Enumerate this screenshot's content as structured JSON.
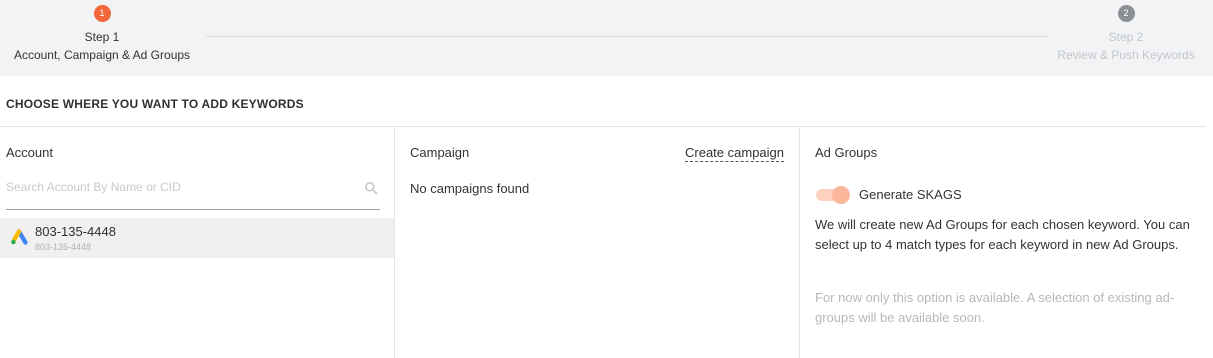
{
  "stepper": {
    "steps": [
      {
        "number": "1",
        "title": "Step 1",
        "subtitle": "Account, Campaign & Ad Groups",
        "state": "active",
        "color": "#f2683a"
      },
      {
        "number": "2",
        "title": "Step 2",
        "subtitle": "Review & Push Keywords",
        "state": "inactive",
        "color": "#8c8f93"
      }
    ]
  },
  "section_title": "CHOOSE WHERE YOU WANT TO ADD KEYWORDS",
  "account": {
    "label": "Account",
    "search": {
      "placeholder": "Search Account By Name or CID",
      "value": ""
    },
    "items": [
      {
        "name": "803-135-4448",
        "id": "803-135-4448",
        "icon": "google-ads-icon",
        "selected": true
      }
    ]
  },
  "campaign": {
    "label": "Campaign",
    "create_link": "Create campaign",
    "empty_text": "No campaigns found"
  },
  "ad_groups": {
    "label": "Ad Groups",
    "toggle": {
      "label": "Generate SKAGS",
      "on": true
    },
    "description": "We will create new Ad Groups for each chosen keyword. You can select up to 4 match types for each keyword in new Ad Groups.",
    "note": "For now only this option is available. A selection of existing ad-groups will be available soon."
  }
}
